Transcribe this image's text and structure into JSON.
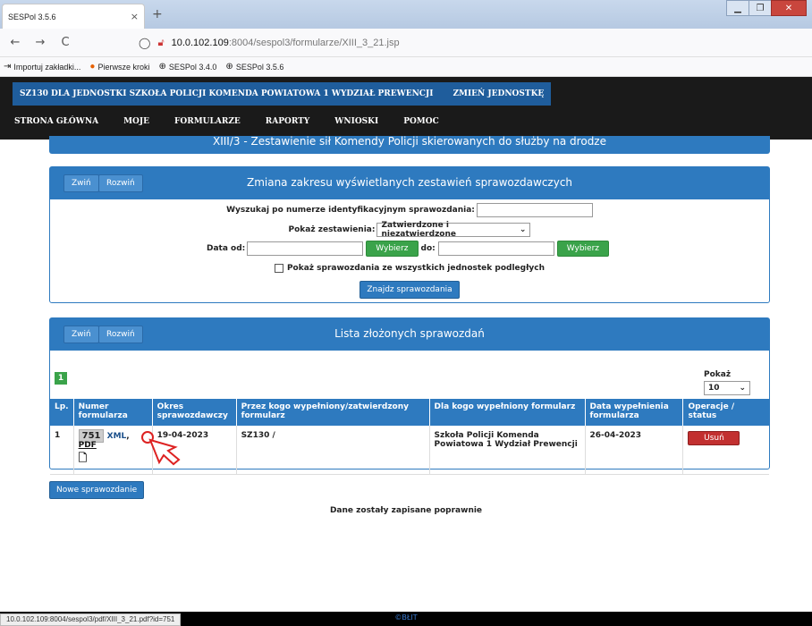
{
  "browser": {
    "tab_title": "SESPol 3.5.6",
    "tab_close": "×",
    "new_tab": "+",
    "back": "←",
    "forward": "→",
    "reload": "C",
    "url_host": "10.0.102.109",
    "url_path": ":8004/sespol3/formularze/XIII_3_21.jsp",
    "bookmarks": [
      {
        "icon": "⇥",
        "label": "Importuj zakładki..."
      },
      {
        "icon": "●",
        "label": "Pierwsze kroki"
      },
      {
        "icon": "⊕",
        "label": "SESPol 3.4.0"
      },
      {
        "icon": "⊕",
        "label": "SESPol 3.5.6"
      }
    ],
    "status_url": "10.0.102.109:8004/sespol3/pdf/XIII_3_21.pdf?id=751"
  },
  "app": {
    "unit_name": "SZ130 DLA JEDNOSTKI SZKOŁA POLICJI KOMENDA POWIATOWA 1 WYDZIAŁ PREWENCJI",
    "change_unit": "ZMIEŃ JEDNOSTKĘ",
    "menu": [
      "STRONA GŁÓWNA",
      "MOJE",
      "FORMULARZE",
      "RAPORTY",
      "WNIOSKI",
      "POMOC"
    ],
    "form_title": "XIII/3 - Zestawienie sił Komendy Policji skierowanych do służby na drodze"
  },
  "search": {
    "collapse": "Zwiń",
    "expand": "Rozwiń",
    "title": "Zmiana zakresu wyświetlanych zestawień sprawozdawczych",
    "id_label": "Wyszukaj po numerze identyfikacyjnym sprawozdania:",
    "id_value": "",
    "show_label": "Pokaż zestawienia:",
    "show_value": "Zatwierdzone i niezatwierdzone",
    "date_from_label": "Data od:",
    "date_to_label": "do:",
    "choose": "Wybierz",
    "subunits_label": "Pokaż sprawozdania ze wszystkich jednostek podległych",
    "find_button": "Znajdz sprawozdania"
  },
  "list": {
    "collapse": "Zwiń",
    "expand": "Rozwiń",
    "title": "Lista złożonych sprawozdań",
    "page": "1",
    "show_label": "Pokaż",
    "show_value": "10",
    "columns": [
      "Lp.",
      "Numer formularza",
      "Okres sprawozdawczy",
      "Przez kogo wypełniony/zatwierdzony formularz",
      "Dla kogo wypełniony formularz",
      "Data wypełnienia formularza",
      "Operacje / status"
    ],
    "rows": [
      {
        "lp": "1",
        "id": "751",
        "xml": "XML",
        "pdf": "PDF",
        "period": "19-04-2023",
        "by": "SZ130 /",
        "for": "Szkoła Policji Komenda Powiatowa 1 Wydział Prewencji",
        "date": "26-04-2023",
        "action": "Usuń"
      }
    ]
  },
  "new_report": "Nowe sprawozdanie",
  "saved_message": "Dane zostały zapisane poprawnie",
  "footer": "©BŁIT"
}
